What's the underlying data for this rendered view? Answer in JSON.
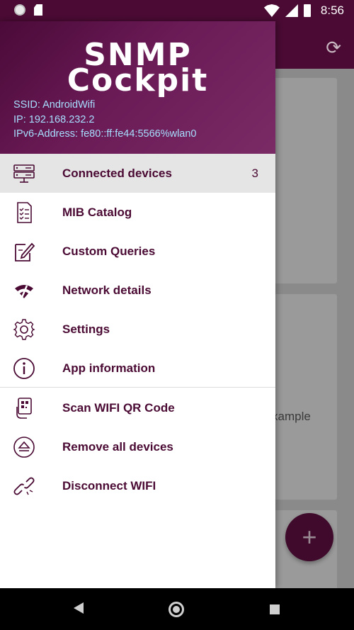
{
  "status_bar": {
    "time": "8:56"
  },
  "drawer": {
    "logo_line1": "SNMP",
    "logo_line2": "Cockpit",
    "ssid": "SSID: AndroidWifi",
    "ip": "IP: 192.168.232.2",
    "ipv6": "IPv6-Address: fe80::ff:fe44:5566%wlan0",
    "items": [
      {
        "label": "Connected devices",
        "count": "3",
        "icon": "server-icon"
      },
      {
        "label": "MIB Catalog",
        "icon": "checklist-icon"
      },
      {
        "label": "Custom Queries",
        "icon": "edit-document-icon"
      },
      {
        "label": "Network details",
        "icon": "wifi-off-icon"
      },
      {
        "label": "Settings",
        "icon": "gear-icon"
      },
      {
        "label": "App information",
        "icon": "info-icon"
      },
      {
        "label": "Scan WIFI QR Code",
        "icon": "qr-scan-icon"
      },
      {
        "label": "Remove all devices",
        "icon": "eject-icon"
      },
      {
        "label": "Disconnect WIFI",
        "icon": "broken-link-icon"
      }
    ]
  },
  "background": {
    "card_text": "xample",
    "fab_symbol": "+"
  },
  "colors": {
    "primary": "#4a0a33",
    "header_text": "#a6dfff",
    "active_bg": "#e5e5e5"
  }
}
